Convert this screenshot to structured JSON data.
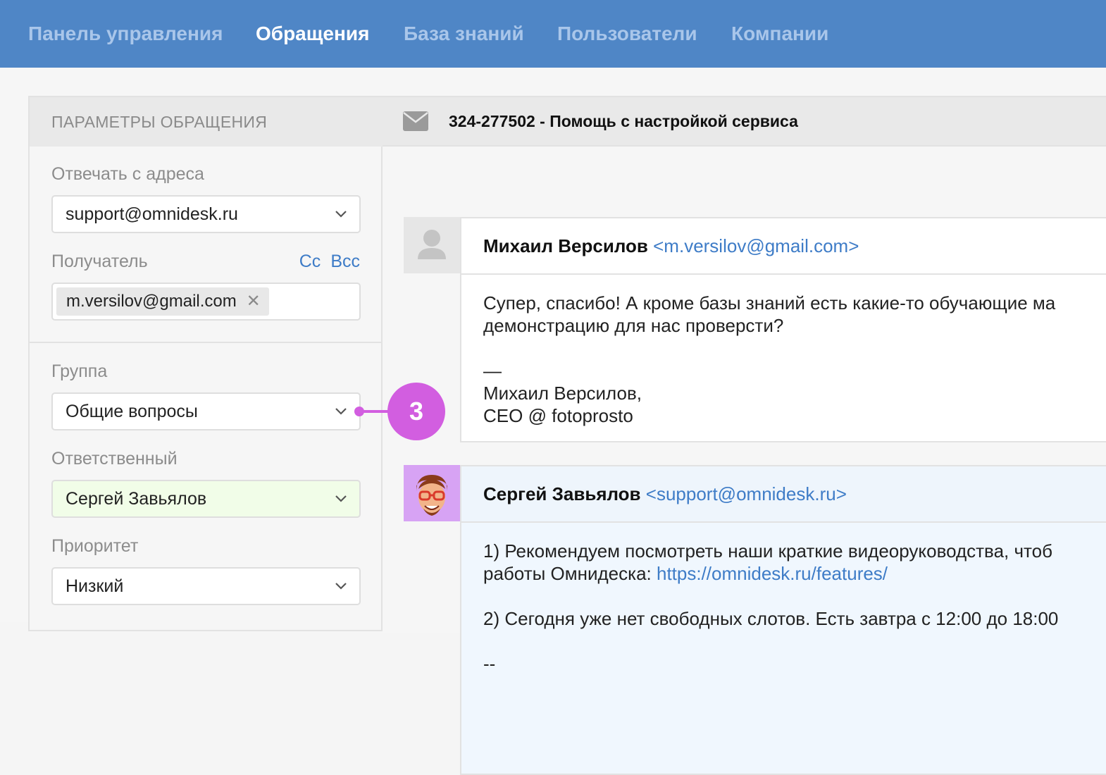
{
  "nav": {
    "items": [
      {
        "label": "Панель управления",
        "active": false
      },
      {
        "label": "Обращения",
        "active": true
      },
      {
        "label": "База знаний",
        "active": false
      },
      {
        "label": "Пользователи",
        "active": false
      },
      {
        "label": "Компании",
        "active": false
      }
    ]
  },
  "sidebar": {
    "title": "ПАРАМЕТРЫ ОБРАЩЕНИЯ",
    "reply_from": {
      "label": "Отвечать с адреса",
      "value": "support@omnidesk.ru"
    },
    "recipient": {
      "label": "Получатель",
      "cc": "Cc",
      "bcc": "Bcc",
      "token": "m.versilov@gmail.com"
    },
    "group": {
      "label": "Группа",
      "value": "Общие вопросы"
    },
    "assignee": {
      "label": "Ответственный",
      "value": "Сергей Завьялов"
    },
    "priority": {
      "label": "Приоритет",
      "value": "Низкий"
    }
  },
  "ticket": {
    "title": "324-277502 - Помощь с настройкой сервиса"
  },
  "messages": [
    {
      "author": "Михаил Версилов",
      "email": "<m.versilov@gmail.com>",
      "body_line1": "Супер, спасибо! А кроме базы знаний есть какие-то обучающие ма",
      "body_line2": "демонстрацию для нас проверсти?",
      "body_line3": "—",
      "body_line4": "Михаил Версилов,",
      "body_line5": "CEO @ fotoprosto"
    },
    {
      "author": "Сергей Завьялов",
      "email": "<support@omnidesk.ru>",
      "body_line1": "1) Рекомендуем посмотреть наши краткие видеоруководства, чтоб",
      "body_line2_prefix": "работы Омнидеска: ",
      "body_line2_link": "https://omnidesk.ru/features/",
      "body_line3": "2) Сегодня уже нет свободных слотов. Есть завтра с 12:00 до 18:00",
      "body_line4": "--"
    }
  ],
  "callout": {
    "number": "3"
  },
  "colors": {
    "nav_bg": "#4f86c6",
    "accent": "#3e7cc7",
    "callout": "#d25ee0"
  }
}
